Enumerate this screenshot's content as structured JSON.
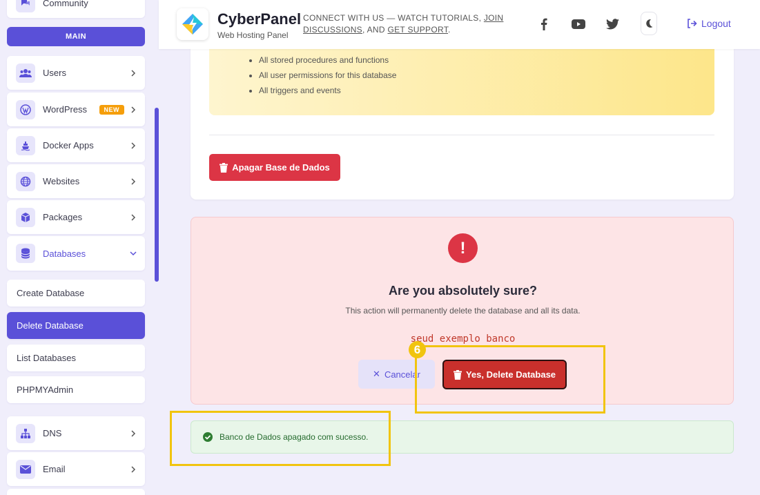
{
  "sidebar": {
    "community_label": "Community",
    "section_main": "MAIN",
    "items": [
      {
        "label": "Users",
        "icon": "users-icon"
      },
      {
        "label": "WordPress",
        "icon": "wordpress-icon",
        "badge": "NEW"
      },
      {
        "label": "Docker Apps",
        "icon": "docker-icon"
      },
      {
        "label": "Websites",
        "icon": "globe-icon"
      },
      {
        "label": "Packages",
        "icon": "package-icon"
      },
      {
        "label": "Databases",
        "icon": "database-icon"
      }
    ],
    "sub_items": [
      {
        "label": "Create Database"
      },
      {
        "label": "Delete Database"
      },
      {
        "label": "List Databases"
      },
      {
        "label": "PHPMYAdmin"
      }
    ],
    "items_bottom": [
      {
        "label": "DNS",
        "icon": "sitemap-icon"
      },
      {
        "label": "Email",
        "icon": "envelope-icon"
      }
    ]
  },
  "header": {
    "brand": "CyberPanel",
    "subtitle": "Web Hosting Panel",
    "connect_prefix": "CONNECT WITH US — WATCH TUTORIALS, ",
    "join_link": "JOIN DISCUSSIONS",
    "connect_mid": ", AND ",
    "support_link": "GET SUPPORT",
    "connect_suffix": ".",
    "logout_label": "Logout"
  },
  "warning_list": [
    "All stored procedures and functions",
    "All user permissions for this database",
    "All triggers and events"
  ],
  "delete_button_label": "Apagar Base de Dados",
  "confirm": {
    "title": "Are you absolutely sure?",
    "description": "This action will permanently delete the database and all its data.",
    "database_name": "seud exemplo banco",
    "cancel_label": "Cancelar",
    "confirm_label": "Yes, Delete Database"
  },
  "success_message": "Banco de Dados apagado com sucesso.",
  "annotation": {
    "step_number": "6"
  },
  "colors": {
    "accent": "#5a50d8",
    "danger": "#dc3545",
    "success": "#256b2e",
    "highlight": "#f1c40f"
  }
}
